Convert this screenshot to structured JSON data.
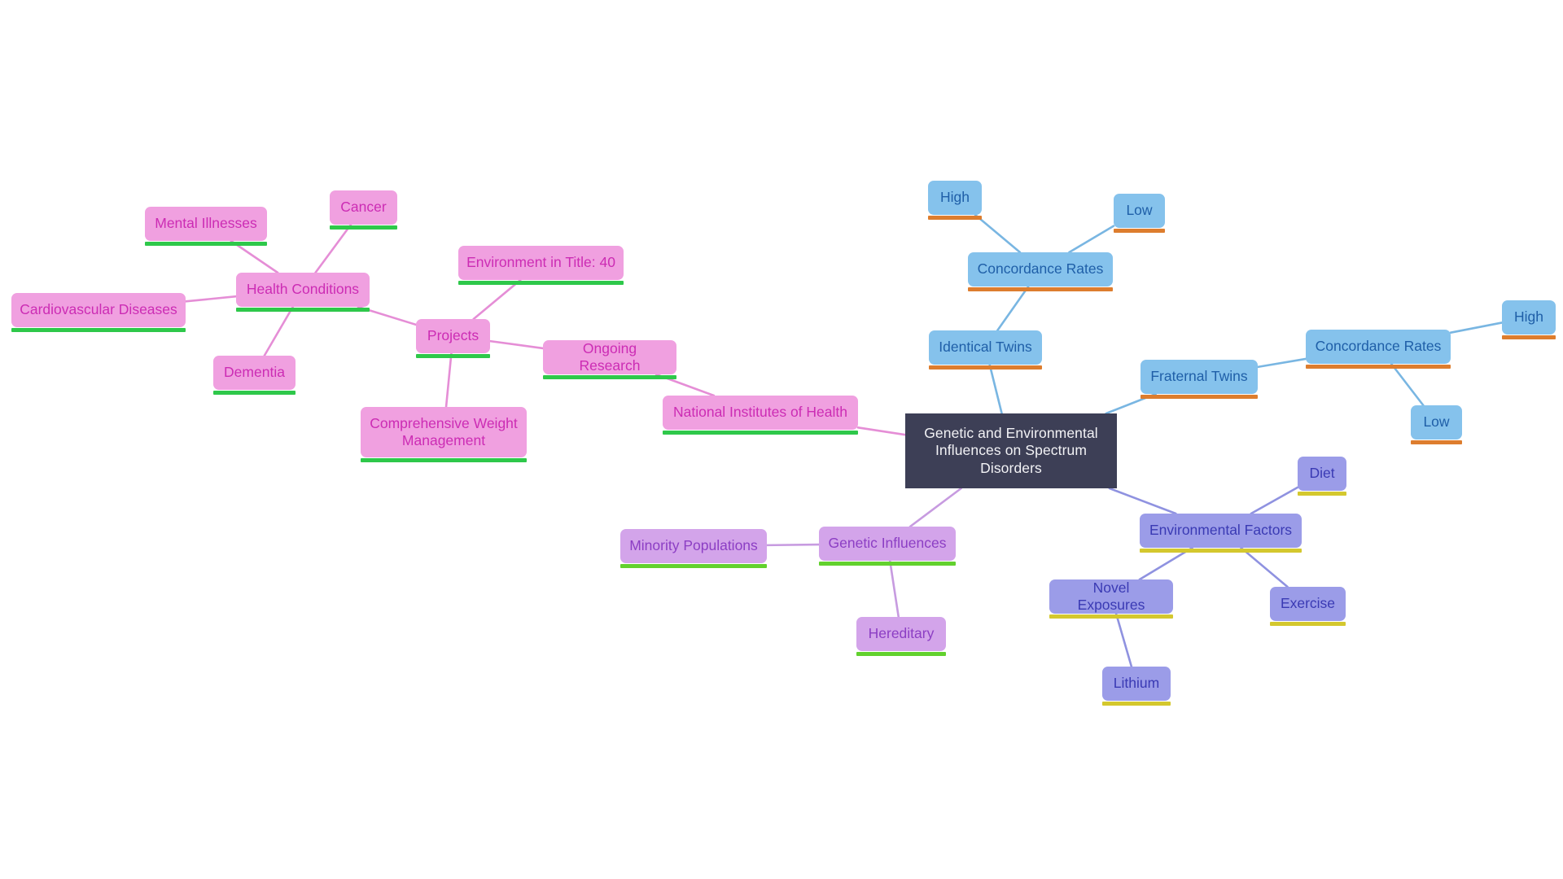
{
  "diagram": {
    "type": "mind-map",
    "background": "#ffffff",
    "root": {
      "id": "root",
      "label": "Genetic and Environmental Influences on Spectrum Disorders",
      "fill": "#3d3f56",
      "text_color": "#f2f2f5"
    },
    "branch_styles": {
      "pink": {
        "fill": "#f0a0e0",
        "text_color": "#cc2cb4",
        "underline": "#2ec84a",
        "edge": "#e58ed6"
      },
      "blue": {
        "fill": "#85c2ec",
        "text_color": "#1f5fa8",
        "underline": "#dd7d2e",
        "edge": "#79b6e2"
      },
      "purple": {
        "fill": "#d3a4ea",
        "text_color": "#8c3ec4",
        "underline": "#62d12e",
        "edge": "#c79be0"
      },
      "peri": {
        "fill": "#9b9ce8",
        "text_color": "#3a3ab4",
        "underline": "#d4c82e",
        "edge": "#8f92e0"
      }
    },
    "nodes": [
      {
        "id": "cardiovascular_diseases",
        "label": "Cardiovascular Diseases",
        "branch": "pink"
      },
      {
        "id": "mental_illnesses",
        "label": "Mental Illnesses",
        "branch": "pink"
      },
      {
        "id": "cancer",
        "label": "Cancer",
        "branch": "pink"
      },
      {
        "id": "health_conditions",
        "label": "Health Conditions",
        "branch": "pink"
      },
      {
        "id": "dementia",
        "label": "Dementia",
        "branch": "pink"
      },
      {
        "id": "projects",
        "label": "Projects",
        "branch": "pink"
      },
      {
        "id": "environment_in_title",
        "label": "Environment in Title: 40",
        "branch": "pink"
      },
      {
        "id": "ongoing_research",
        "label": "Ongoing Research",
        "branch": "pink"
      },
      {
        "id": "comprehensive_weight_management",
        "label": "Comprehensive Weight\nManagement",
        "branch": "pink"
      },
      {
        "id": "national_institutes_of_health",
        "label": "National Institutes of Health",
        "branch": "pink"
      },
      {
        "id": "identical_twins",
        "label": "Identical Twins",
        "branch": "blue"
      },
      {
        "id": "concordance_rates_identical",
        "label": "Concordance Rates",
        "branch": "blue"
      },
      {
        "id": "high_identical",
        "label": "High",
        "branch": "blue"
      },
      {
        "id": "low_identical",
        "label": "Low",
        "branch": "blue"
      },
      {
        "id": "fraternal_twins",
        "label": "Fraternal Twins",
        "branch": "blue"
      },
      {
        "id": "concordance_rates_fraternal",
        "label": "Concordance Rates",
        "branch": "blue"
      },
      {
        "id": "high_fraternal",
        "label": "High",
        "branch": "blue"
      },
      {
        "id": "low_fraternal",
        "label": "Low",
        "branch": "blue"
      },
      {
        "id": "genetic_influences",
        "label": "Genetic Influences",
        "branch": "purple"
      },
      {
        "id": "minority_populations",
        "label": "Minority Populations",
        "branch": "purple"
      },
      {
        "id": "hereditary",
        "label": "Hereditary",
        "branch": "purple"
      },
      {
        "id": "environmental_factors",
        "label": "Environmental Factors",
        "branch": "peri"
      },
      {
        "id": "diet",
        "label": "Diet",
        "branch": "peri"
      },
      {
        "id": "exercise",
        "label": "Exercise",
        "branch": "peri"
      },
      {
        "id": "novel_exposures",
        "label": "Novel Exposures",
        "branch": "peri"
      },
      {
        "id": "lithium",
        "label": "Lithium",
        "branch": "peri"
      }
    ],
    "edges": [
      {
        "from": "root",
        "to": "national_institutes_of_health",
        "branch": "pink"
      },
      {
        "from": "national_institutes_of_health",
        "to": "ongoing_research",
        "branch": "pink"
      },
      {
        "from": "ongoing_research",
        "to": "projects",
        "branch": "pink"
      },
      {
        "from": "projects",
        "to": "environment_in_title",
        "branch": "pink"
      },
      {
        "from": "projects",
        "to": "comprehensive_weight_management",
        "branch": "pink"
      },
      {
        "from": "projects",
        "to": "health_conditions",
        "branch": "pink"
      },
      {
        "from": "health_conditions",
        "to": "cardiovascular_diseases",
        "branch": "pink"
      },
      {
        "from": "health_conditions",
        "to": "mental_illnesses",
        "branch": "pink"
      },
      {
        "from": "health_conditions",
        "to": "cancer",
        "branch": "pink"
      },
      {
        "from": "health_conditions",
        "to": "dementia",
        "branch": "pink"
      },
      {
        "from": "root",
        "to": "identical_twins",
        "branch": "blue"
      },
      {
        "from": "identical_twins",
        "to": "concordance_rates_identical",
        "branch": "blue"
      },
      {
        "from": "concordance_rates_identical",
        "to": "high_identical",
        "branch": "blue"
      },
      {
        "from": "concordance_rates_identical",
        "to": "low_identical",
        "branch": "blue"
      },
      {
        "from": "root",
        "to": "fraternal_twins",
        "branch": "blue"
      },
      {
        "from": "fraternal_twins",
        "to": "concordance_rates_fraternal",
        "branch": "blue"
      },
      {
        "from": "concordance_rates_fraternal",
        "to": "high_fraternal",
        "branch": "blue"
      },
      {
        "from": "concordance_rates_fraternal",
        "to": "low_fraternal",
        "branch": "blue"
      },
      {
        "from": "root",
        "to": "genetic_influences",
        "branch": "purple"
      },
      {
        "from": "genetic_influences",
        "to": "minority_populations",
        "branch": "purple"
      },
      {
        "from": "genetic_influences",
        "to": "hereditary",
        "branch": "purple"
      },
      {
        "from": "root",
        "to": "environmental_factors",
        "branch": "peri"
      },
      {
        "from": "environmental_factors",
        "to": "diet",
        "branch": "peri"
      },
      {
        "from": "environmental_factors",
        "to": "exercise",
        "branch": "peri"
      },
      {
        "from": "environmental_factors",
        "to": "novel_exposures",
        "branch": "peri"
      },
      {
        "from": "novel_exposures",
        "to": "lithium",
        "branch": "peri"
      }
    ]
  }
}
